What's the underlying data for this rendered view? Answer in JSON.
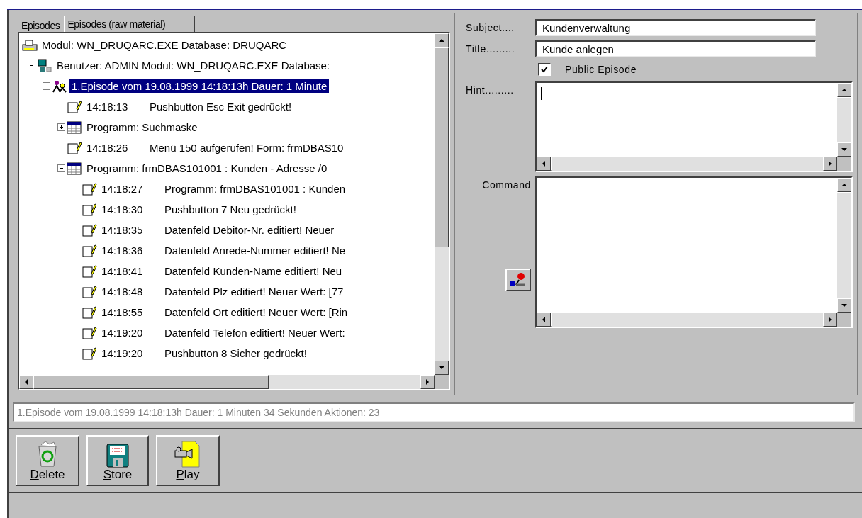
{
  "tabs": [
    {
      "label": "Episodes",
      "selected": false
    },
    {
      "label": "Episodes (raw material)",
      "selected": true
    }
  ],
  "tree": [
    {
      "kind": "module",
      "text": "Modul: WN_DRUQARC.EXE Database: DRUQARC",
      "selected": false,
      "children": [
        {
          "kind": "user",
          "text": "Benutzer: ADMIN Modul: WN_DRUQARC.EXE Database:",
          "expanded": true,
          "selected": false,
          "children": [
            {
              "kind": "episode",
              "text": "1.Episode  vom 19.08.1999 14:18:13h Dauer: 1 Minute",
              "expanded": true,
              "selected": true,
              "children": [
                {
                  "kind": "action",
                  "time": "14:18:13",
                  "text": "Pushbutton Esc Exit gedrückt!",
                  "selected": false
                },
                {
                  "kind": "program",
                  "text": "Programm: Suchmaske",
                  "expanded": false,
                  "selected": false
                },
                {
                  "kind": "action",
                  "time": "14:18:26",
                  "text": "Menü 150 aufgerufen! Form: frmDBAS10",
                  "selected": false
                },
                {
                  "kind": "program",
                  "text": "Programm: frmDBAS101001 : Kunden - Adresse /0",
                  "expanded": true,
                  "selected": false,
                  "children": [
                    {
                      "kind": "action",
                      "time": "14:18:27",
                      "text": "Programm: frmDBAS101001 : Kunden",
                      "selected": false
                    },
                    {
                      "kind": "action",
                      "time": "14:18:30",
                      "text": "Pushbutton 7 Neu gedrückt!",
                      "selected": false
                    },
                    {
                      "kind": "action",
                      "time": "14:18:35",
                      "text": "Datenfeld Debitor-Nr. editiert! Neuer",
                      "selected": false
                    },
                    {
                      "kind": "action",
                      "time": "14:18:36",
                      "text": "Datenfeld Anrede-Nummer editiert! Ne",
                      "selected": false
                    },
                    {
                      "kind": "action",
                      "time": "14:18:41",
                      "text": "Datenfeld Kunden-Name editiert! Neu",
                      "selected": false
                    },
                    {
                      "kind": "action",
                      "time": "14:18:48",
                      "text": "Datenfeld Plz editiert! Neuer Wert: [77",
                      "selected": false
                    },
                    {
                      "kind": "action",
                      "time": "14:18:55",
                      "text": "Datenfeld Ort editiert! Neuer Wert: [Rin",
                      "selected": false
                    },
                    {
                      "kind": "action",
                      "time": "14:19:20",
                      "text": "Datenfeld Telefon editiert! Neuer Wert:",
                      "selected": false
                    },
                    {
                      "kind": "action",
                      "time": "14:19:20",
                      "text": "Pushbutton 8 Sicher gedrückt!",
                      "selected": false
                    }
                  ]
                }
              ]
            }
          ]
        }
      ]
    }
  ],
  "form": {
    "subject": {
      "label": "Subject....",
      "value": "Kundenverwaltung"
    },
    "title": {
      "label": "Title.........",
      "value": "Kunde anlegen"
    },
    "public": {
      "label": "Public Episode",
      "checked": true
    },
    "hint": {
      "label": "Hint.........",
      "focused": true
    },
    "command": {
      "label": "Command"
    }
  },
  "status": "1.Episode  vom 19.08.1999 14:18:13h Dauer: 1 Minuten 34 Sekunden  Aktionen: 23",
  "buttons": [
    {
      "kind": "delete",
      "label": "Delete"
    },
    {
      "kind": "store",
      "label": "Store"
    },
    {
      "kind": "play",
      "label": "Play"
    }
  ]
}
